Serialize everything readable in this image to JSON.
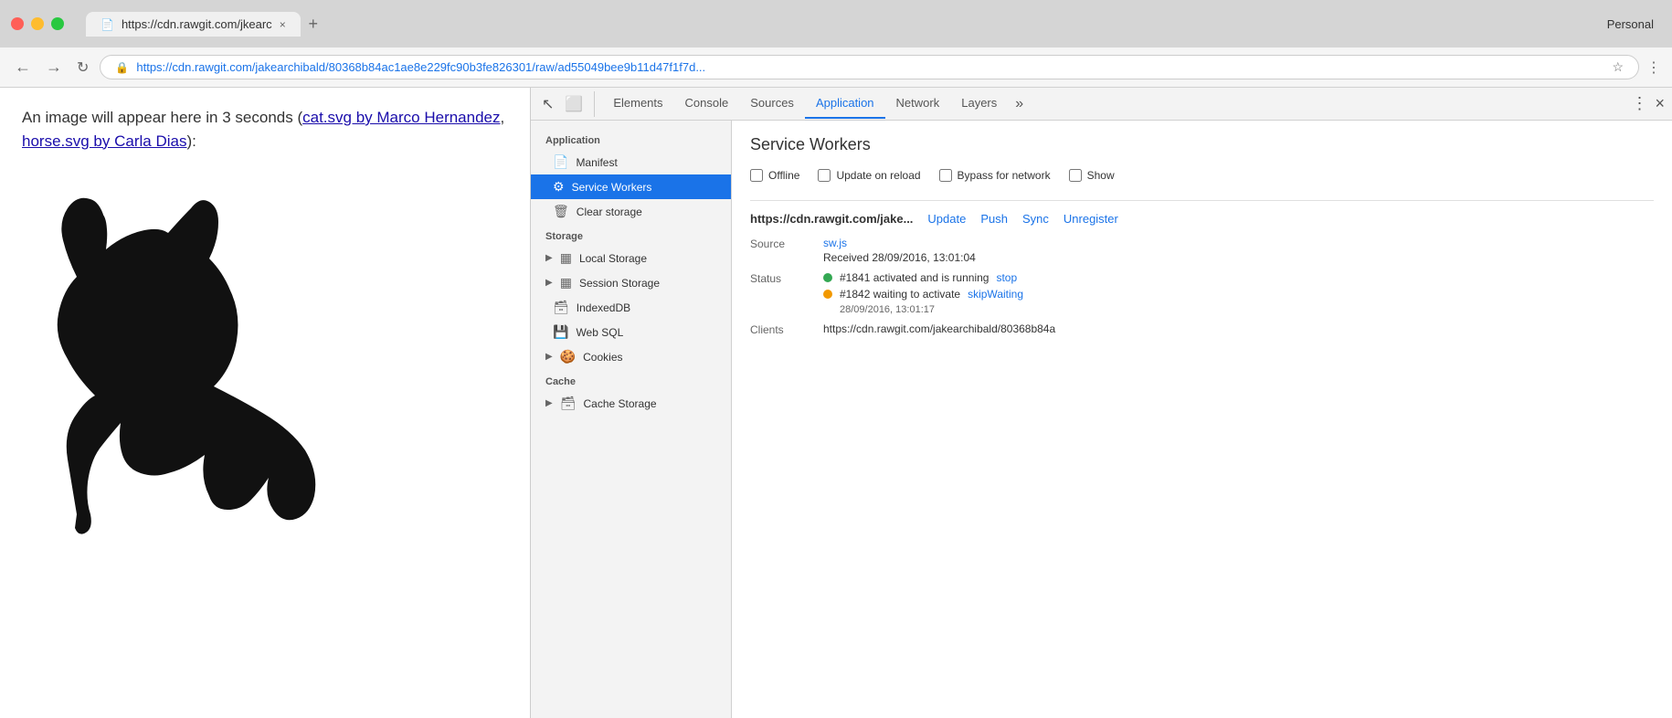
{
  "browser": {
    "title_bar": {
      "tab_url": "https://cdn.rawgit.com/jkearc",
      "tab_close": "×",
      "profile": "Personal"
    },
    "nav": {
      "back": "←",
      "forward": "→",
      "reload": "↻",
      "url_full": "https://cdn.rawgit.com/jakearchibald/80368b84ac1ae8e229fc90b3fe826301/raw/ad55049bee9b11d47f1f7d...",
      "url_display": "https://cdn.rawgit.com/jakearchibald/80368b84ac1ae8e229fc90b3fe826301/raw/ad55049bee9b11d47f1f7d...",
      "secure_icon": "🔒"
    }
  },
  "page": {
    "intro_text": "An image will appear here in 3 seconds (",
    "link1_text": "cat.svg by Marco Hernandez",
    "comma": ", ",
    "link2_text": "horse.svg by Carla Dias",
    "outro_text": "):"
  },
  "devtools": {
    "tabs": [
      {
        "id": "elements",
        "label": "Elements"
      },
      {
        "id": "console",
        "label": "Console"
      },
      {
        "id": "sources",
        "label": "Sources"
      },
      {
        "id": "application",
        "label": "Application",
        "active": true
      },
      {
        "id": "network",
        "label": "Network"
      },
      {
        "id": "layers",
        "label": "Layers"
      }
    ],
    "more_tabs": "»",
    "sidebar": {
      "sections": [
        {
          "label": "Application",
          "items": [
            {
              "id": "manifest",
              "label": "Manifest",
              "icon": "📄"
            },
            {
              "id": "service-workers",
              "label": "Service Workers",
              "icon": "⚙",
              "active": true
            },
            {
              "id": "clear-storage",
              "label": "Clear storage",
              "icon": "🗑"
            }
          ]
        },
        {
          "label": "Storage",
          "items": [
            {
              "id": "local-storage",
              "label": "Local Storage",
              "icon": "▶",
              "has_arrow": true
            },
            {
              "id": "session-storage",
              "label": "Session Storage",
              "icon": "▶",
              "has_arrow": true
            },
            {
              "id": "indexeddb",
              "label": "IndexedDB",
              "icon": "🗃",
              "indent": true
            },
            {
              "id": "web-sql",
              "label": "Web SQL",
              "icon": "💾",
              "indent": true
            },
            {
              "id": "cookies",
              "label": "Cookies",
              "icon": "▶",
              "has_arrow": true
            }
          ]
        },
        {
          "label": "Cache",
          "items": [
            {
              "id": "cache-storage",
              "label": "Cache Storage",
              "icon": "▶",
              "has_arrow": true
            }
          ]
        }
      ]
    },
    "panel": {
      "title": "Service Workers",
      "checkboxes": [
        {
          "id": "offline",
          "label": "Offline",
          "checked": false
        },
        {
          "id": "update-on-reload",
          "label": "Update on reload",
          "checked": false
        },
        {
          "id": "bypass-for-network",
          "label": "Bypass for network",
          "checked": false
        },
        {
          "id": "show",
          "label": "Show",
          "checked": false
        }
      ],
      "service_worker": {
        "url": "https://cdn.rawgit.com/jake...",
        "actions": [
          "Update",
          "Push",
          "Sync",
          "Unregister"
        ],
        "source_label": "Source",
        "source_file": "sw.js",
        "received": "Received 28/09/2016, 13:01:04",
        "status_label": "Status",
        "statuses": [
          {
            "dot_color": "green",
            "text": "#1841 activated and is running",
            "action": "stop"
          },
          {
            "dot_color": "orange",
            "text": "#1842 waiting to activate",
            "action": "skipWaiting",
            "received": "28/09/2016, 13:01:17"
          }
        ],
        "clients_label": "Clients",
        "clients_value": "https://cdn.rawgit.com/jakearchibald/80368b84a"
      }
    }
  }
}
